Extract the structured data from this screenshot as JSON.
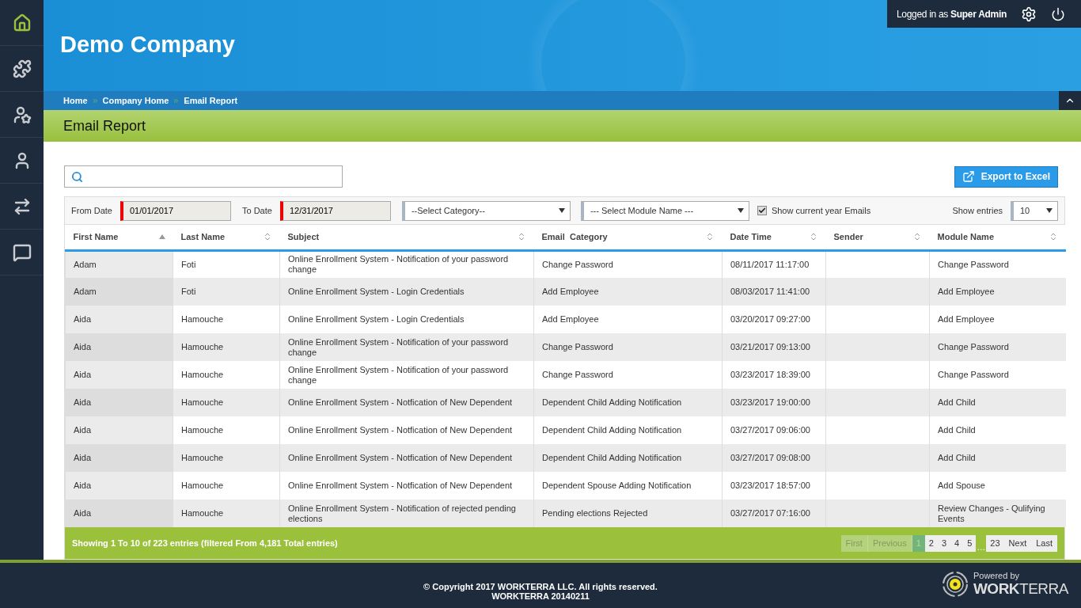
{
  "sidebar": {
    "items": [
      {
        "kind": "home",
        "selected": true
      },
      {
        "kind": "puzzle",
        "selected": false
      },
      {
        "kind": "user-star",
        "selected": false
      },
      {
        "kind": "user",
        "selected": false
      },
      {
        "kind": "swap",
        "selected": false
      },
      {
        "kind": "chat",
        "selected": false
      }
    ]
  },
  "header": {
    "company": "Demo Company",
    "user_prefix": "Logged in as",
    "user_name": "Super Admin"
  },
  "breadcrumb": [
    "Home",
    "Company Home",
    "Email Report"
  ],
  "page_title": "Email Report",
  "export_button": "Export to Excel",
  "filters": {
    "from_label": "From Date",
    "from_value": "01/01/2017",
    "to_label": "To Date",
    "to_value": "12/31/2017",
    "category": "--Select Category--",
    "module": "--- Select Module Name ---",
    "current_year_label": "Show current year Emails",
    "current_year_checked": true,
    "entries_label": "Show entries",
    "entries_value": "10"
  },
  "table": {
    "columns": [
      {
        "label": "First Name",
        "sorted": true
      },
      {
        "label": "Last Name",
        "sorted": false
      },
      {
        "label": "Subject",
        "sorted": false
      },
      {
        "label": "Email  Category",
        "sorted": false
      },
      {
        "label": "Date Time",
        "sorted": false
      },
      {
        "label": "Sender",
        "sorted": false
      },
      {
        "label": "Module Name",
        "sorted": false
      }
    ],
    "rows": [
      [
        "Adam",
        "Foti",
        "Online Enrollment System - Notification of your password change",
        "Change Password",
        "08/11/2017 11:17:00",
        "",
        "Change Password"
      ],
      [
        "Adam",
        "Foti",
        "Online Enrollment System - Login Credentials",
        "Add Employee",
        "08/03/2017 11:41:00",
        "",
        "Add Employee"
      ],
      [
        "Aida",
        "Hamouche",
        "Online Enrollment System - Login Credentials",
        "Add Employee",
        "03/20/2017 09:27:00",
        "",
        "Add Employee"
      ],
      [
        "Aida",
        "Hamouche",
        "Online Enrollment System - Notification of your password change",
        "Change Password",
        "03/21/2017 09:13:00",
        "",
        "Change Password"
      ],
      [
        "Aida",
        "Hamouche",
        "Online Enrollment System - Notification of your password change",
        "Change Password",
        "03/23/2017 18:39:00",
        "",
        "Change Password"
      ],
      [
        "Aida",
        "Hamouche",
        "Online Enrollment System - Notfication of New Dependent",
        "Dependent Child Adding Notification",
        "03/23/2017 19:00:00",
        "",
        "Add Child"
      ],
      [
        "Aida",
        "Hamouche",
        "Online Enrollment System - Notfication of New Dependent",
        "Dependent Child Adding Notification",
        "03/27/2017 09:06:00",
        "",
        "Add Child"
      ],
      [
        "Aida",
        "Hamouche",
        "Online Enrollment System - Notfication of New Dependent",
        "Dependent Child Adding Notification",
        "03/27/2017 09:08:00",
        "",
        "Add Child"
      ],
      [
        "Aida",
        "Hamouche",
        "Online Enrollment System - Notfication of New Dependent",
        "Dependent Spouse Adding Notification",
        "03/23/2017 18:57:00",
        "",
        "Add Spouse"
      ],
      [
        "Aida",
        "Hamouche",
        "Online Enrollment System - Notification of rejected pending elections",
        "Pending elections Rejected",
        "03/27/2017 07:16:00",
        "",
        "Review Changes - Qulifying Events"
      ]
    ]
  },
  "summary": "Showing 1 To 10 of 223 entries (filtered From 4,181 Total entries)",
  "pagination": {
    "start": [
      {
        "label": "First",
        "disabled": true
      },
      {
        "label": "Previous",
        "disabled": true
      }
    ],
    "pages": [
      {
        "label": "1",
        "selected": true
      },
      {
        "label": "2",
        "selected": false
      },
      {
        "label": "3",
        "selected": false
      },
      {
        "label": "4",
        "selected": false
      },
      {
        "label": "5",
        "selected": false
      }
    ],
    "gap": "…",
    "tail_pages": [
      {
        "label": "23",
        "selected": false
      }
    ],
    "end": [
      {
        "label": "Next",
        "disabled": false
      },
      {
        "label": "Last",
        "disabled": false
      }
    ]
  },
  "footer": {
    "copyright": "© Copyright 2017 WORKTERRA LLC. All rights reserved.",
    "version": "WORKTERRA 20140211",
    "powered_by": "Powered by",
    "brand": "**WORK**TERRA"
  }
}
